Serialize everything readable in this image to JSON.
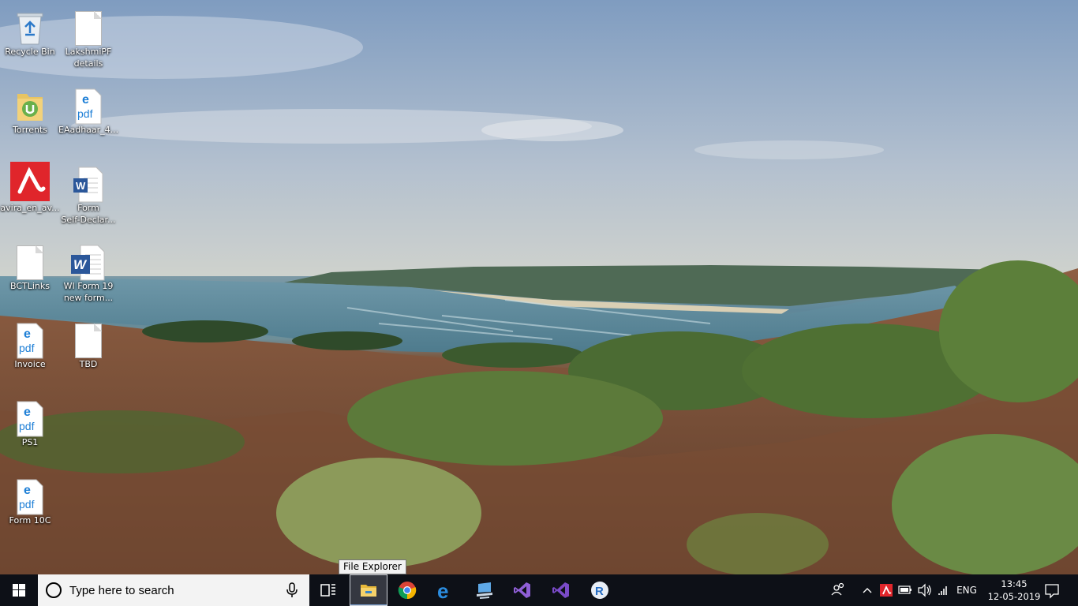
{
  "desktop": {
    "icons": [
      {
        "label": "Recycle Bin",
        "icon": "recycle-bin-icon"
      },
      {
        "label": "LakshmiPF\ndetails",
        "icon": "text-file-icon"
      },
      {
        "label": "Torrents",
        "icon": "folder-icon"
      },
      {
        "label": "EAadhaar_4...",
        "icon": "edge-pdf-icon"
      },
      {
        "label": "avira_en_av...",
        "icon": "avira-icon"
      },
      {
        "label": "Form\nSelf-Declar...",
        "icon": "word-doc-icon"
      },
      {
        "label": "BCTLinks",
        "icon": "text-file-icon"
      },
      {
        "label": "WI Form 19\nnew form...",
        "icon": "word-doc-icon"
      },
      {
        "label": "Invoice",
        "icon": "edge-pdf-icon"
      },
      {
        "label": "TBD",
        "icon": "text-file-icon"
      },
      {
        "label": "PS1",
        "icon": "edge-pdf-icon"
      },
      {
        "label": "Form 10C",
        "icon": "edge-pdf-icon"
      }
    ]
  },
  "tooltip": {
    "text": "File Explorer"
  },
  "taskbar": {
    "search_placeholder": "Type here to search",
    "apps": [
      {
        "name": "task-view",
        "icon": "task-view-icon"
      },
      {
        "name": "file-explorer",
        "icon": "folder-icon"
      },
      {
        "name": "chrome",
        "icon": "chrome-icon"
      },
      {
        "name": "edge",
        "icon": "edge-icon"
      },
      {
        "name": "remote-desktop",
        "icon": "computer-icon"
      },
      {
        "name": "visual-studio",
        "icon": "visual-studio-icon"
      },
      {
        "name": "visual-studio-alt",
        "icon": "visual-studio-icon"
      },
      {
        "name": "r",
        "icon": "r-icon"
      }
    ],
    "tray": {
      "language": "ENG",
      "time": "13:45",
      "date": "12-05-2019"
    }
  },
  "colors": {
    "taskbar": "#0d1017",
    "accent": "#7da4d8",
    "pdf_blue": "#1e7fd6",
    "avira_red": "#e0252b"
  }
}
